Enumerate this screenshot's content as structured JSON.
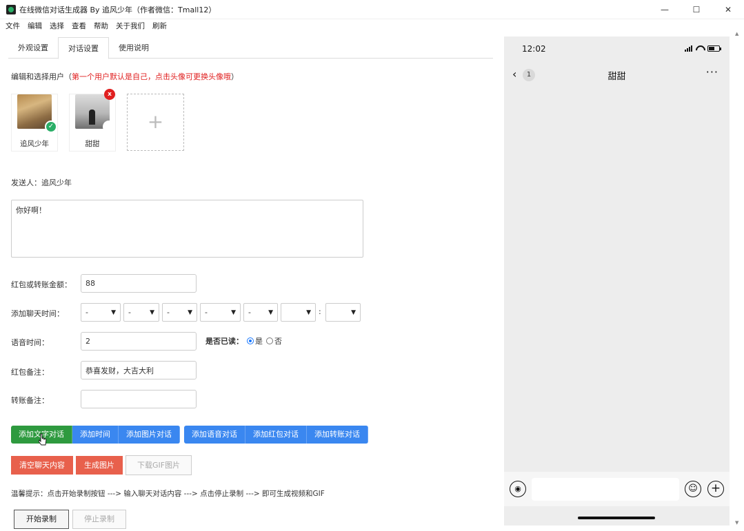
{
  "window": {
    "title": "在线微信对话生成器 By 追风少年（作者微信：Tmall12）",
    "minimize": "—",
    "maximize": "☐",
    "close": "✕"
  },
  "menu": [
    "文件",
    "编辑",
    "选择",
    "查看",
    "帮助",
    "关于我们",
    "刷新"
  ],
  "tabs": [
    {
      "label": "外观设置"
    },
    {
      "label": "对话设置"
    },
    {
      "label": "使用说明"
    }
  ],
  "hint": {
    "prefix": "编辑和选择用户（",
    "red": "第一个用户默认是自己，点击头像可更换头像哦",
    "suffix": "）"
  },
  "users": [
    {
      "name": "追风少年"
    },
    {
      "name": "甜甜"
    }
  ],
  "add_user_symbol": "+",
  "sender": {
    "label": "发送人：追风少年"
  },
  "message": {
    "value": "你好啊！"
  },
  "form": {
    "amount_label": "红包或转账金额：",
    "amount_value": "88",
    "chat_time_label": "添加聊天时间：",
    "time_selects": [
      "-",
      "-",
      "-",
      "-",
      "-",
      "",
      ""
    ],
    "time_colon": ":",
    "voice_label": "语音时间：",
    "voice_value": "2",
    "read_label": "是否已读：",
    "read_yes": "是",
    "read_no": "否",
    "hongbao_note_label": "红包备注：",
    "hongbao_note_value": "恭喜发财，大吉大利",
    "transfer_note_label": "转账备注：",
    "transfer_note_value": ""
  },
  "buttons": {
    "add_text": "添加文字对话",
    "add_time": "添加时间",
    "add_image": "添加图片对话",
    "add_voice": "添加语音对话",
    "add_hongbao": "添加红包对话",
    "add_transfer": "添加转账对话",
    "clear": "清空聊天内容",
    "generate": "生成图片",
    "download_gif": "下载GIF图片"
  },
  "tip": "温馨提示：点击开始录制按钮 ---> 输入聊天对话内容 ---> 点击停止录制 ---> 即可生成视频和GIF",
  "record": {
    "start": "开始录制",
    "stop": "停止录制"
  },
  "phone": {
    "time": "12:02",
    "unread": "1",
    "chat_title": "甜甜",
    "more": "···",
    "back": "‹"
  },
  "colors": {
    "green": "#2e9a3f",
    "blue": "#3a87f0",
    "red": "#e8604c",
    "phone_bg": "#ededed"
  }
}
